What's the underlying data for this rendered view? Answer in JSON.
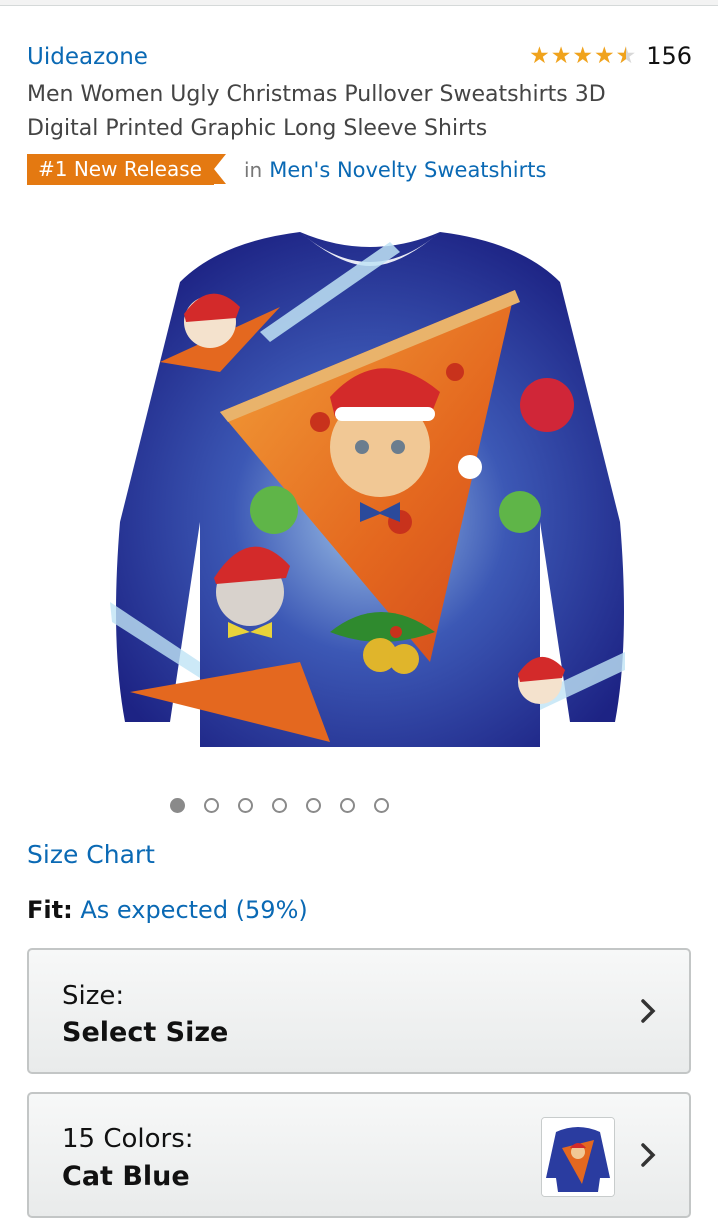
{
  "product": {
    "brand": "Uideazone",
    "rating": {
      "stars": 4.5,
      "count": "156"
    },
    "title": "Men Women Ugly Christmas Pullover Sweatshirts 3D Digital Printed Graphic Long Sleeve Shirts",
    "badge": "#1 New Release",
    "in_text": "in",
    "category": "Men's Novelty Sweatshirts"
  },
  "gallery": {
    "image_count": 7,
    "active_index": 0
  },
  "size_chart_link": "Size Chart",
  "fit": {
    "label": "Fit:",
    "value": "As expected (59%)"
  },
  "options": {
    "size": {
      "label": "Size:",
      "value": "Select Size"
    },
    "color": {
      "label": "15 Colors:",
      "value": "Cat Blue"
    }
  },
  "colors": {
    "link": "#0a69b4",
    "badge": "#e47911",
    "star": "#f0a31d"
  }
}
